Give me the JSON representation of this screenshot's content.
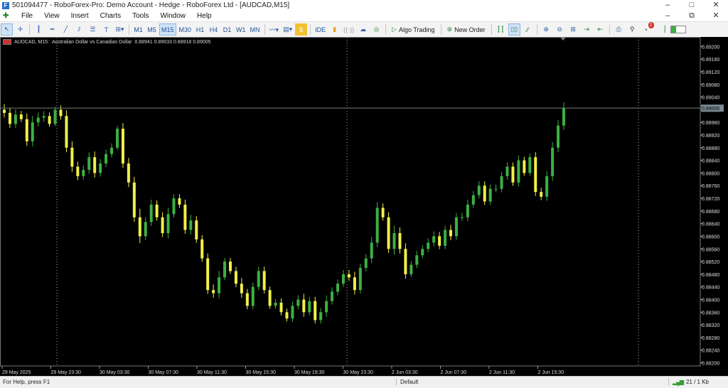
{
  "window": {
    "title": "501094477 - RoboForex-Pro: Demo Account - Hedge - RoboForex Ltd - [AUDCAD,M15]",
    "controls": [
      "–",
      "□",
      "✕"
    ]
  },
  "menubar": {
    "items": [
      "File",
      "View",
      "Insert",
      "Charts",
      "Tools",
      "Window",
      "Help"
    ],
    "right": [
      "–",
      "⧉",
      "✕"
    ]
  },
  "toolbar": {
    "timeframes": [
      "M1",
      "M5",
      "M15",
      "M30",
      "H1",
      "H4",
      "D1",
      "W1",
      "MN"
    ],
    "active_timeframe": "M15",
    "ide_label": "IDE",
    "algo_trading_label": "Algo Trading",
    "new_order_label": "New Order",
    "notification_count": "1"
  },
  "chart_header": {
    "symbol": "AUDCAD, M15:",
    "description": "Australian Dollar vs Canadian Dollar",
    "ohlc": "0.88941 0.89033 0.88918 0.89005"
  },
  "chart_data": {
    "type": "candlestick",
    "symbol": "AUDCAD",
    "timeframe": "M15",
    "y_ticks": [
      "0.89200",
      "0.89160",
      "0.89120",
      "0.89080",
      "0.89040",
      "0.89000",
      "0.88960",
      "0.88920",
      "0.88880",
      "0.88840",
      "0.88800",
      "0.88760",
      "0.88720",
      "0.88680",
      "0.88640",
      "0.88600",
      "0.88560",
      "0.88520",
      "0.88480",
      "0.88440",
      "0.88400",
      "0.88360",
      "0.88320",
      "0.88280",
      "0.88240",
      "0.88200"
    ],
    "ylim": [
      0.8819,
      0.8923
    ],
    "current_price": "0.89005",
    "x_labels": [
      "29 May 2025",
      "29 May 23:30",
      "30 May 03:30",
      "30 May 07:30",
      "30 May 11:30",
      "30 May 15:30",
      "30 May 19:30",
      "30 May 23:30",
      "2 Jun 03:30",
      "2 Jun 07:30",
      "2 Jun 11:30",
      "2 Jun 15:30"
    ],
    "up_color": "#3cb043",
    "down_color": "#f0f04a",
    "bg_color": "#000000",
    "close_path": [
      [
        0.8899,
        8
      ],
      [
        0.88955,
        7
      ],
      [
        0.88985,
        7
      ],
      [
        0.8897,
        5
      ],
      [
        0.889,
        8
      ],
      [
        0.8896,
        9
      ],
      [
        0.88975,
        7
      ],
      [
        0.8898,
        7
      ],
      [
        0.88955,
        5
      ],
      [
        0.89,
        4
      ],
      [
        0.8898,
        6
      ],
      [
        0.8888,
        8
      ],
      [
        0.8882,
        9
      ],
      [
        0.8879,
        7
      ],
      [
        0.8881,
        6
      ],
      [
        0.8885,
        7
      ],
      [
        0.888,
        8
      ],
      [
        0.8883,
        6
      ],
      [
        0.8886,
        6
      ],
      [
        0.8888,
        6
      ],
      [
        0.8894,
        4
      ],
      [
        0.8883,
        8
      ],
      [
        0.8877,
        8
      ],
      [
        0.8866,
        8
      ],
      [
        0.886,
        12
      ],
      [
        0.88645,
        7
      ],
      [
        0.887,
        7
      ],
      [
        0.8866,
        6
      ],
      [
        0.8861,
        7
      ],
      [
        0.8867,
        9
      ],
      [
        0.8872,
        6
      ],
      [
        0.887,
        6
      ],
      [
        0.8862,
        7
      ],
      [
        0.8865,
        8
      ],
      [
        0.8859,
        6
      ],
      [
        0.8853,
        6
      ],
      [
        0.8843,
        7
      ],
      [
        0.8842,
        8
      ],
      [
        0.8847,
        9
      ],
      [
        0.8852,
        5
      ],
      [
        0.8849,
        5
      ],
      [
        0.8845,
        6
      ],
      [
        0.8842,
        8
      ],
      [
        0.8838,
        6
      ],
      [
        0.8844,
        6
      ],
      [
        0.8849,
        6
      ],
      [
        0.8843,
        6
      ],
      [
        0.8838,
        5
      ],
      [
        0.8839,
        5
      ],
      [
        0.8836,
        6
      ],
      [
        0.8834,
        5
      ],
      [
        0.8838,
        6
      ],
      [
        0.884,
        6
      ],
      [
        0.8836,
        8
      ],
      [
        0.88395,
        6
      ],
      [
        0.88335,
        6
      ],
      [
        0.8836,
        6
      ],
      [
        0.88395,
        8
      ],
      [
        0.88425,
        6
      ],
      [
        0.8845,
        6
      ],
      [
        0.8848,
        6
      ],
      [
        0.8847,
        6
      ],
      [
        0.8843,
        8
      ],
      [
        0.885,
        6
      ],
      [
        0.8853,
        6
      ],
      [
        0.8858,
        8
      ],
      [
        0.8869,
        8
      ],
      [
        0.8866,
        6
      ],
      [
        0.8856,
        7
      ],
      [
        0.8861,
        10
      ],
      [
        0.8856,
        8
      ],
      [
        0.8848,
        8
      ],
      [
        0.8851,
        5
      ],
      [
        0.8854,
        6
      ],
      [
        0.8856,
        5
      ],
      [
        0.8858,
        6
      ],
      [
        0.886,
        7
      ],
      [
        0.8857,
        6
      ],
      [
        0.8862,
        6
      ],
      [
        0.886,
        7
      ],
      [
        0.8866,
        6
      ],
      [
        0.8866,
        6
      ],
      [
        0.887,
        7
      ],
      [
        0.8873,
        6
      ],
      [
        0.8876,
        6
      ],
      [
        0.8871,
        6
      ],
      [
        0.8875,
        6
      ],
      [
        0.8875,
        6
      ],
      [
        0.8879,
        6
      ],
      [
        0.8882,
        6
      ],
      [
        0.8877,
        6
      ],
      [
        0.8884,
        7
      ],
      [
        0.888,
        5
      ],
      [
        0.8885,
        5
      ],
      [
        0.8874,
        7
      ],
      [
        0.88725,
        6
      ],
      [
        0.8879,
        7
      ],
      [
        0.8888,
        8
      ],
      [
        0.8895,
        8
      ],
      [
        0.89005,
        8
      ]
    ]
  }
}
